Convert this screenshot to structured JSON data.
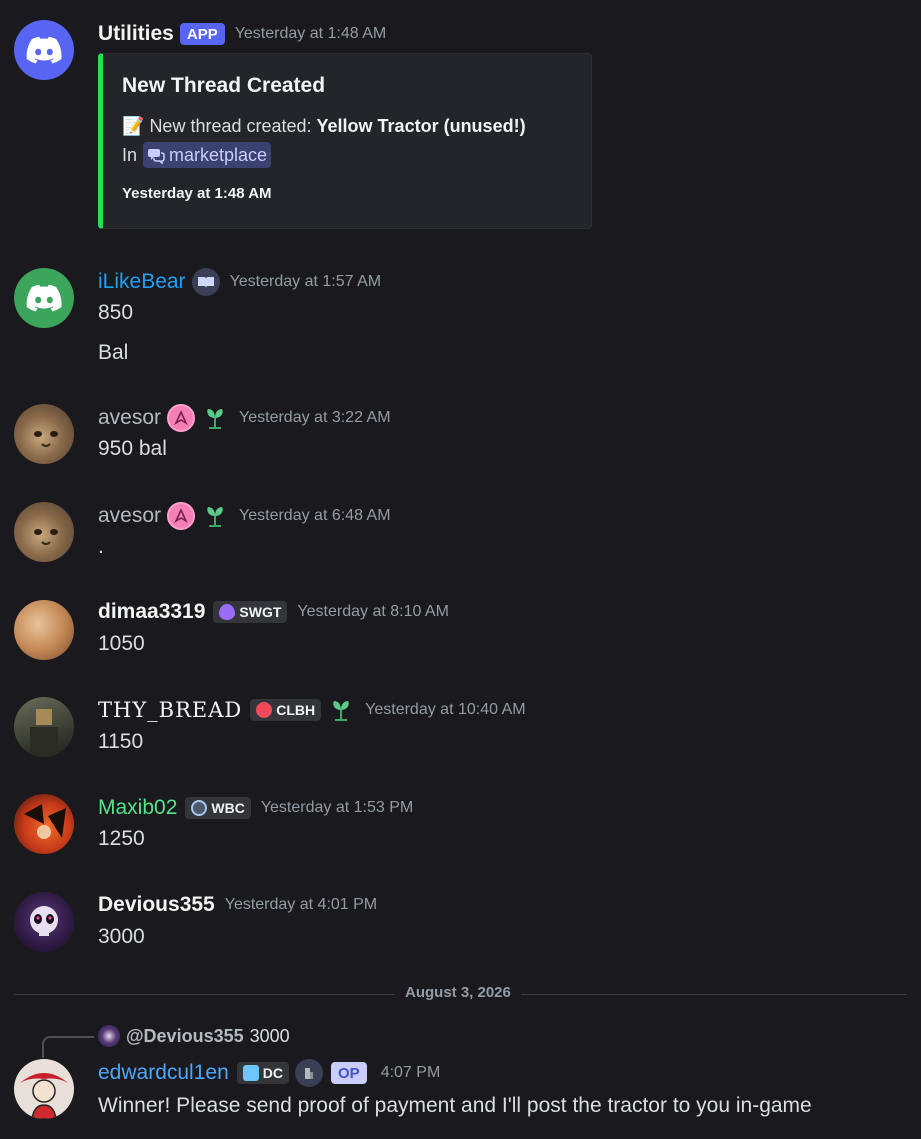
{
  "messages": {
    "utilities": {
      "username": "Utilities",
      "app_tag": "APP",
      "timestamp": "Yesterday at 1:48 AM",
      "embed": {
        "title": "New Thread Created",
        "emoji": "📝",
        "prefix": "New thread created: ",
        "thread_name": "Yellow Tractor (unused!)",
        "in_label": "In",
        "channel": "marketplace",
        "footer": "Yesterday at 1:48 AM"
      }
    },
    "ilikebear": {
      "username": "iLikeBear",
      "timestamp": "Yesterday at 1:57 AM",
      "lines": [
        "850",
        "Bal"
      ]
    },
    "avesor1": {
      "username": "avesor",
      "timestamp": "Yesterday at 3:22 AM",
      "text": "950 bal"
    },
    "avesor2": {
      "username": "avesor",
      "timestamp": "Yesterday at 6:48 AM",
      "text": "."
    },
    "dimaa": {
      "username": "dimaa3319",
      "tag": "SWGT",
      "timestamp": "Yesterday at 8:10 AM",
      "text": "1050"
    },
    "thybread": {
      "username": "THY_BREAD",
      "tag": "CLBH",
      "timestamp": "Yesterday at 10:40 AM",
      "text": "1150"
    },
    "maxib": {
      "username": "Maxib02",
      "tag": "WBC",
      "timestamp": "Yesterday at 1:53 PM",
      "text": "1250"
    },
    "devious": {
      "username": "Devious355",
      "timestamp": "Yesterday at 4:01 PM",
      "text": "3000"
    },
    "edward": {
      "reply_user": "@Devious355",
      "reply_text": "3000",
      "username": "edwardcul1en",
      "tag": "DC",
      "op_tag": "OP",
      "timestamp": "4:07 PM",
      "text": "Winner! Please send proof of payment and I'll post the tractor to you in-game"
    }
  },
  "date_divider": "August 3, 2026",
  "colors": {
    "background": "#1a1a1e",
    "embed_accent": "#23e05a",
    "ilikebear_name": "#1fa1f2",
    "maxib_name": "#57e389",
    "edward_name": "#4aa8ff",
    "avesor_name": "#b5bac1"
  }
}
